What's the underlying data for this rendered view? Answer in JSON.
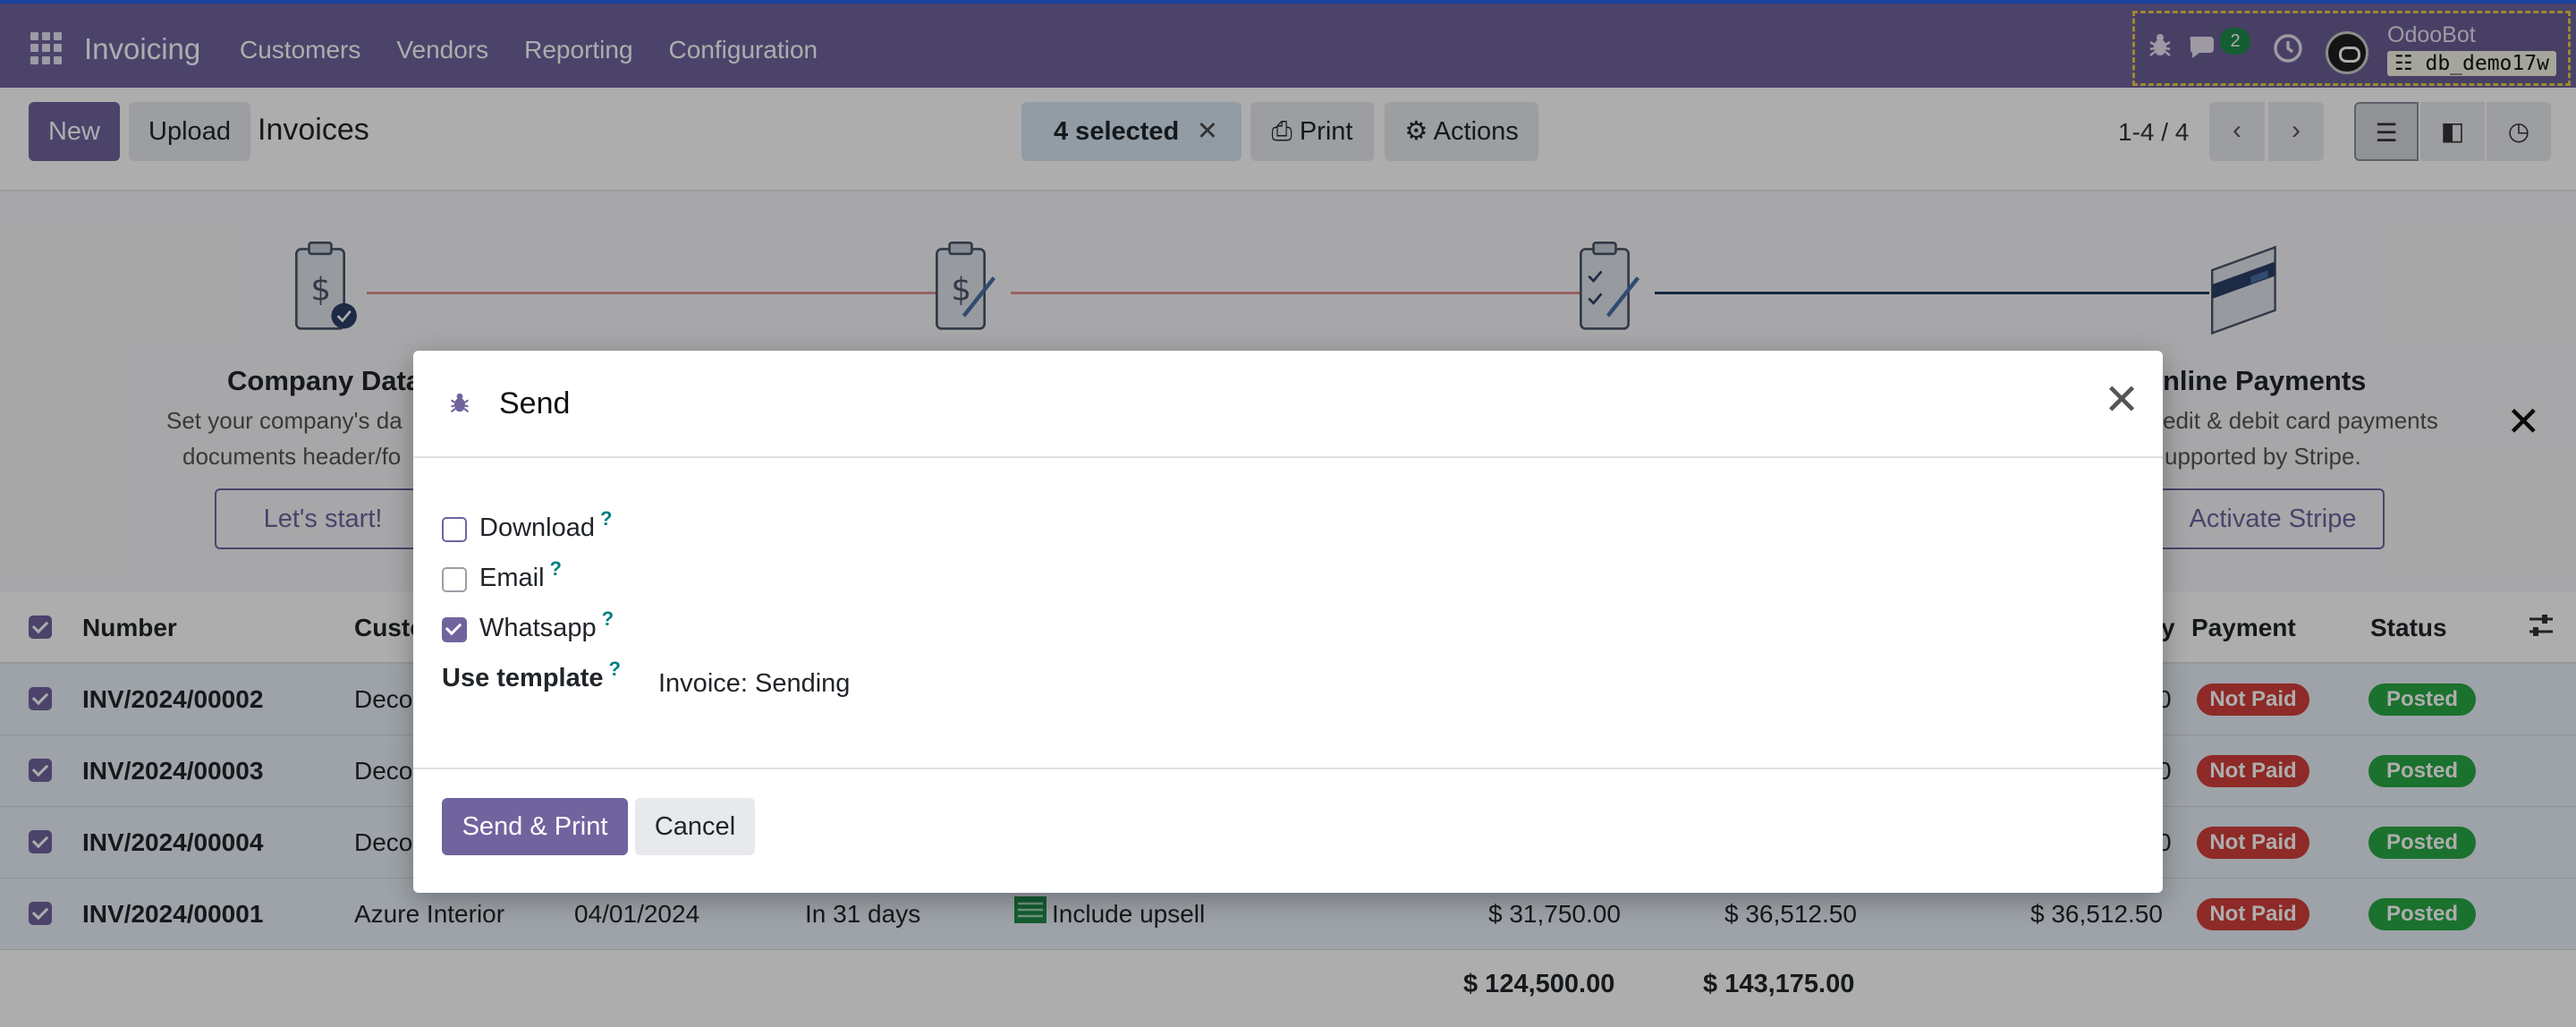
{
  "navbar": {
    "brand": "Invoicing",
    "menu": [
      "Customers",
      "Vendors",
      "Reporting",
      "Configuration"
    ],
    "chat_count": "2",
    "user_name": "OdooBot",
    "db_name": "db_demo17w"
  },
  "control_panel": {
    "new_label": "New",
    "upload_label": "Upload",
    "title": "Invoices",
    "selected_label": "4 selected",
    "print_label": "Print",
    "actions_label": "Actions",
    "pager": "1-4 / 4"
  },
  "banner": {
    "steps": [
      {
        "title": "Company Data",
        "desc_line1": "Set your company's da",
        "desc_line2": "documents header/fo",
        "button": "Let's start!"
      },
      {
        "title": "nline Payments",
        "desc_line1": "edit & debit card payments",
        "desc_line2": "upported by Stripe.",
        "button": "Activate Stripe"
      }
    ]
  },
  "list": {
    "headers": {
      "number": "Number",
      "customer": "Custo",
      "due": "y",
      "payment": "Payment",
      "status": "Status"
    },
    "rows": [
      {
        "number": "INV/2024/00002",
        "customer": "Deco",
        "due_amount": "0",
        "payment": "Not Paid",
        "status": "Posted"
      },
      {
        "number": "INV/2024/00003",
        "customer": "Deco",
        "due_amount": "0",
        "payment": "Not Paid",
        "status": "Posted"
      },
      {
        "number": "INV/2024/00004",
        "customer": "Deco",
        "due_amount": "0",
        "payment": "Not Paid",
        "status": "Posted"
      },
      {
        "number": "INV/2024/00001",
        "customer": "Azure Interior",
        "date": "04/01/2024",
        "due": "In 31 days",
        "activity": "Include upsell",
        "untaxed": "$ 31,750.00",
        "total": "$ 36,512.50",
        "due_amount": "$ 36,512.50",
        "payment": "Not Paid",
        "status": "Posted"
      }
    ],
    "footer": {
      "untaxed_total": "$ 124,500.00",
      "total": "$ 143,175.00"
    }
  },
  "modal": {
    "title": "Send",
    "options": [
      {
        "label": "Download",
        "checked": false,
        "help": "?"
      },
      {
        "label": "Email",
        "checked": false,
        "help": "?"
      },
      {
        "label": "Whatsapp",
        "checked": true,
        "help": "?"
      }
    ],
    "template_label": "Use template",
    "template_help": "?",
    "template_value": "Invoice: Sending",
    "primary_button": "Send & Print",
    "cancel_button": "Cancel"
  },
  "colors": {
    "brand": "#71639e",
    "danger": "#d23f3a",
    "success": "#28a745",
    "help": "#017e84"
  }
}
